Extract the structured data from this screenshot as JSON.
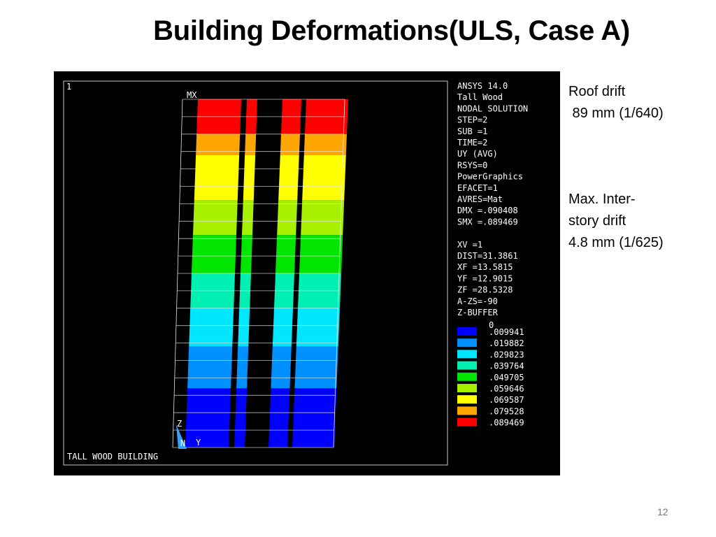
{
  "slide": {
    "title": "Building Deformations(ULS, Case A)",
    "page_number": "12"
  },
  "notes": {
    "roof_drift_label": "Roof drift",
    "roof_drift_value": " 89 mm (1/640)",
    "interstory_line1": "Max. Inter-",
    "interstory_line2": "story drift",
    "interstory_value": "4.8 mm (1/625)"
  },
  "ansys": {
    "window_number": "1",
    "max_marker": "MX",
    "footer_title": "TALL WOOD BUILDING",
    "triad": {
      "z": "Z",
      "n": "N",
      "y": "Y"
    },
    "info_lines": [
      "ANSYS 14.0",
      "Tall Wood",
      "NODAL SOLUTION",
      "STEP=2",
      "SUB =1",
      "TIME=2",
      "UY       (AVG)",
      "RSYS=0",
      "PowerGraphics",
      "EFACET=1",
      "AVRES=Mat",
      "DMX =.090408",
      "SMX =.089469",
      "",
      "XV  =1",
      "DIST=31.3861",
      "XF  =13.5815",
      "YF  =12.9015",
      "ZF  =28.5328",
      "A-ZS=-90",
      "Z-BUFFER"
    ],
    "legend": {
      "min_label": "0",
      "entries": [
        {
          "value": ".009941",
          "color": "#0000ff"
        },
        {
          "value": ".019882",
          "color": "#0090ff"
        },
        {
          "value": ".029823",
          "color": "#00e6ff"
        },
        {
          "value": ".039764",
          "color": "#00f0b4"
        },
        {
          "value": ".049705",
          "color": "#00e600"
        },
        {
          "value": ".059646",
          "color": "#a6f000"
        },
        {
          "value": ".069587",
          "color": "#ffff00"
        },
        {
          "value": ".079528",
          "color": "#ffa500"
        },
        {
          "value": ".089469",
          "color": "#ff0000"
        }
      ]
    }
  }
}
